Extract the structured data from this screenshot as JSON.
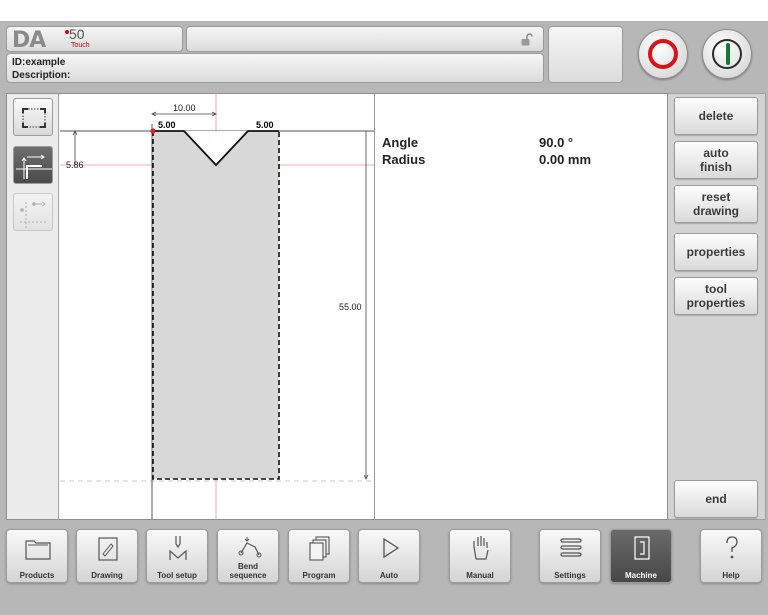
{
  "header": {
    "logo": {
      "brand": "DA",
      "model": "50",
      "edition": "Touch"
    },
    "id_line": "ID:example",
    "description_line": "Description:"
  },
  "canvas": {
    "dim_top_width": "10.00",
    "dim_left_length": "5.00",
    "dim_right_length": "5.00",
    "dim_depth": "5.86",
    "dim_height": "55.00"
  },
  "properties": [
    {
      "label": "Angle",
      "value": "90.0 °"
    },
    {
      "label": "Radius",
      "value": "0.00 mm"
    }
  ],
  "side_buttons": {
    "delete": "delete",
    "auto_finish": "auto\nfinish",
    "reset_drawing": "reset\ndrawing",
    "properties": "properties",
    "tool_properties": "tool\nproperties",
    "end": "end"
  },
  "nav": [
    {
      "label": "Products",
      "icon": "folder-icon"
    },
    {
      "label": "Drawing",
      "icon": "pencil-icon"
    },
    {
      "label": "Tool setup",
      "icon": "tool-setup-icon"
    },
    {
      "label": "Bend\nsequence",
      "icon": "bend-sequence-icon"
    },
    {
      "label": "Program",
      "icon": "pages-icon"
    },
    {
      "label": "Auto",
      "icon": "play-icon"
    },
    {
      "label": "Manual",
      "icon": "hand-icon"
    },
    {
      "label": "Settings",
      "icon": "list-icon"
    },
    {
      "label": "Machine",
      "icon": "machine-icon",
      "active": true
    },
    {
      "label": "Help",
      "icon": "question-icon"
    }
  ],
  "colors": {
    "stop_ring": "#d8141b",
    "start_bar": "#137a35",
    "active_tab": "#555555",
    "reference_line": "#e06060"
  }
}
